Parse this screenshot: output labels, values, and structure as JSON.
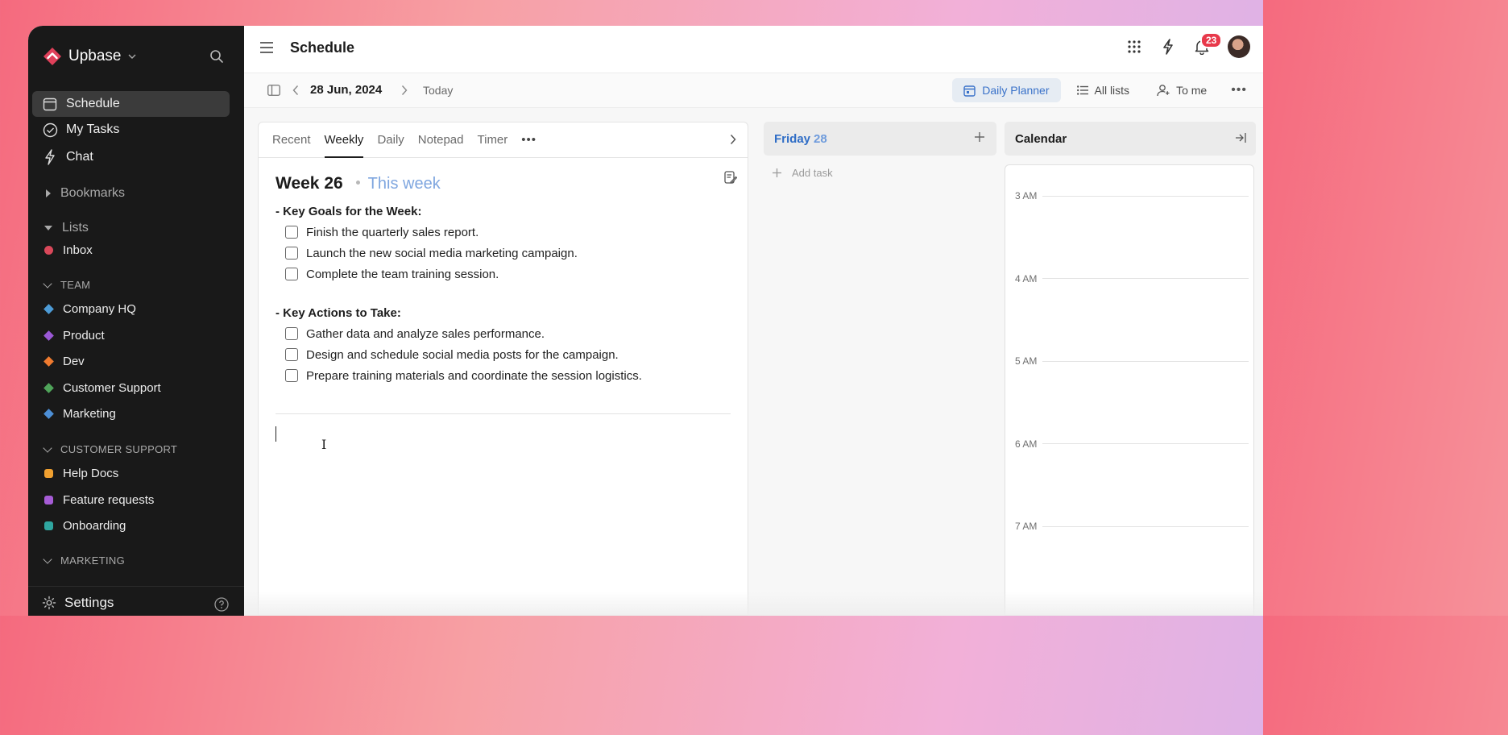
{
  "app": {
    "brand": "Upbase",
    "page_title": "Schedule",
    "notification_count": "23"
  },
  "sidebar": {
    "nav": [
      {
        "label": "Schedule",
        "icon": "calendar-icon"
      },
      {
        "label": "My Tasks",
        "icon": "check-circle-icon"
      },
      {
        "label": "Chat",
        "icon": "bolt-icon"
      }
    ],
    "bookmarks_label": "Bookmarks",
    "lists_label": "Lists",
    "inbox_label": "Inbox",
    "team_label": "TEAM",
    "team_items": [
      {
        "label": "Company HQ",
        "color": "#4d9bd6"
      },
      {
        "label": "Product",
        "color": "#9b59d6"
      },
      {
        "label": "Dev",
        "color": "#f07b2f"
      },
      {
        "label": "Customer Support",
        "color": "#4fa45a"
      },
      {
        "label": "Marketing",
        "color": "#4d8fd6"
      }
    ],
    "cs_label": "CUSTOMER SUPPORT",
    "cs_items": [
      {
        "label": "Help Docs",
        "color": "#f0a030"
      },
      {
        "label": "Feature requests",
        "color": "#a65cd6"
      },
      {
        "label": "Onboarding",
        "color": "#2fa6a0"
      }
    ],
    "marketing_label": "MARKETING",
    "settings_label": "Settings"
  },
  "subbar": {
    "date": "28 Jun, 2024",
    "today": "Today",
    "daily_planner": "Daily Planner",
    "all_lists": "All lists",
    "to_me": "To me"
  },
  "note": {
    "tabs": [
      "Recent",
      "Weekly",
      "Daily",
      "Notepad",
      "Timer"
    ],
    "active_tab": "Weekly",
    "week_title": "Week 26",
    "week_sub": "This week",
    "goals_heading": "- Key Goals for the Week:",
    "goals": [
      "Finish the quarterly sales report.",
      "Launch the new social media marketing campaign.",
      "Complete the team training session."
    ],
    "actions_heading": "- Key Actions to Take:",
    "actions": [
      "Gather data and analyze sales performance.",
      "Design and schedule social media posts for the campaign.",
      "Prepare training materials and coordinate the session logistics."
    ]
  },
  "day": {
    "name": "Friday",
    "num": "28",
    "add_task": "Add task"
  },
  "calendar": {
    "title": "Calendar",
    "hours": [
      "3 AM",
      "4 AM",
      "5 AM",
      "6 AM",
      "7 AM"
    ]
  },
  "colors": {
    "sidebar_bg": "#191919",
    "accent": "#3a72c9",
    "badge": "#e8394b",
    "inbox_dot": "#d9485a"
  }
}
